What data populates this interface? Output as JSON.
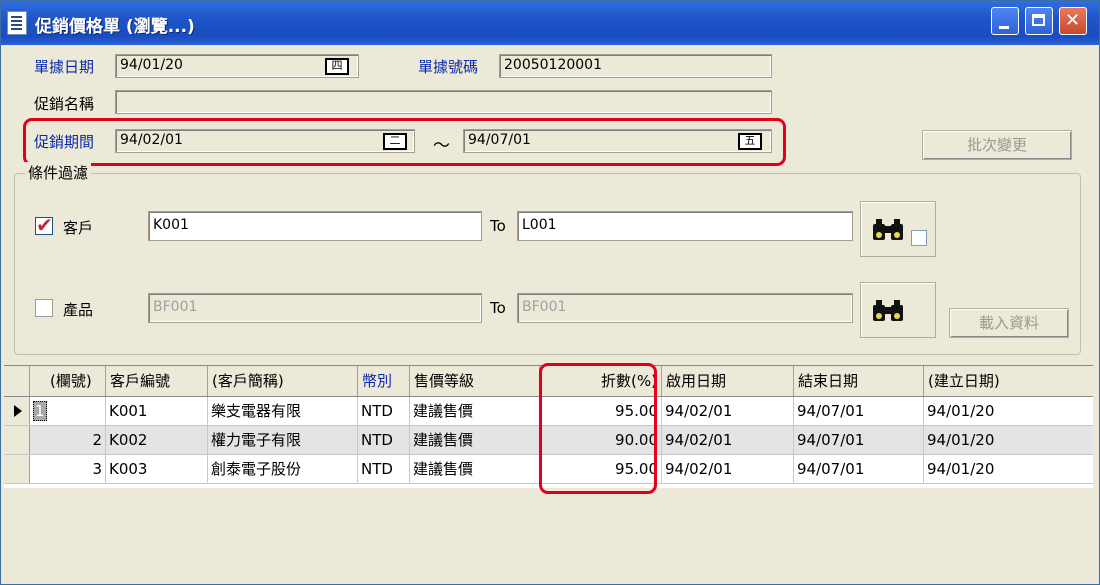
{
  "window": {
    "title": "促銷價格單 (瀏覽...)",
    "icons": {
      "app": "document-edit-icon",
      "minimize": "minimize-icon",
      "maximize": "maximize-icon",
      "close": "close-icon"
    }
  },
  "form": {
    "doc_date_label": "單據日期",
    "doc_date_value": "94/01/20",
    "doc_no_label": "單據號碼",
    "doc_no_value": "20050120001",
    "promo_name_label": "促銷名稱",
    "promo_name_value": "",
    "period_label": "促銷期間",
    "period_start": "94/02/01",
    "period_separator": "～",
    "period_end": "94/07/01",
    "cal_icon_1": "四",
    "cal_icon_2": "二",
    "cal_icon_3": "五",
    "batch_change_button": "批次變更"
  },
  "filter": {
    "group_title": "條件過濾",
    "customer": {
      "label": "客戶",
      "checked": true,
      "from": "K001",
      "to_label": "To",
      "to": "L001"
    },
    "product": {
      "label": "產品",
      "checked": false,
      "from": "BF001",
      "to_label": "To",
      "to": "BF001"
    },
    "load_button": "載入資料"
  },
  "grid": {
    "columns": [
      "(欄號)",
      "客戶編號",
      "(客戶簡稱)",
      "幣別",
      "售價等級",
      "折數(%)",
      "啟用日期",
      "結束日期",
      "(建立日期)"
    ],
    "rows": [
      {
        "no": "1",
        "cust_id": "K001",
        "cust_name": "樂支電器有限",
        "currency": "NTD",
        "price_level": "建議售價",
        "discount": "95.00",
        "start": "94/02/01",
        "end": "94/07/01",
        "created": "94/01/20"
      },
      {
        "no": "2",
        "cust_id": "K002",
        "cust_name": "權力電子有限",
        "currency": "NTD",
        "price_level": "建議售價",
        "discount": "90.00",
        "start": "94/02/01",
        "end": "94/07/01",
        "created": "94/01/20"
      },
      {
        "no": "3",
        "cust_id": "K003",
        "cust_name": "創泰電子股份",
        "currency": "NTD",
        "price_level": "建議售價",
        "discount": "95.00",
        "start": "94/02/01",
        "end": "94/07/01",
        "created": "94/01/20"
      }
    ]
  },
  "colors": {
    "title_bar": "#1f55c8",
    "highlight": "#e0001b",
    "label_blue": "#0b2aa8",
    "face": "#ece9d8"
  }
}
